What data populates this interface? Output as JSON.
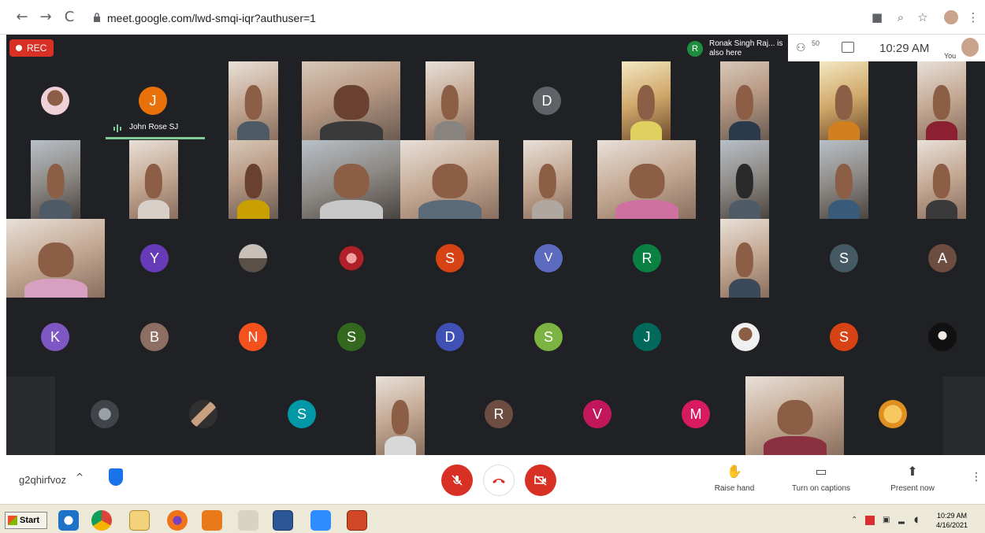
{
  "browser": {
    "url": "meet.google.com/lwd-smqi-iqr?authuser=1",
    "back": "←",
    "forward": "→",
    "reload": "C",
    "icons": [
      "camera-icon",
      "zoom-icon",
      "bookmark-star-icon",
      "profile-avatar",
      "menu-icon"
    ]
  },
  "meet": {
    "rec_label": "REC",
    "notification": {
      "initial": "R",
      "text": "Ronak Singh Raj... is also here"
    },
    "people_count": "50",
    "clock": "10:29 AM",
    "you_label": "You",
    "active_speaker": "John Rose SJ",
    "avatars": {
      "j": "J",
      "d": "D",
      "y": "Y",
      "s1": "S",
      "v1": "V",
      "r1": "R",
      "s2": "S",
      "a": "A",
      "k": "K",
      "b": "B",
      "n": "N",
      "s3": "S",
      "d2": "D",
      "s4": "S",
      "j2": "J",
      "s5": "S",
      "s6": "S",
      "r2": "R",
      "v2": "V",
      "m": "M"
    },
    "avatar_colors": {
      "orange": "#e8710a",
      "grey": "#5f6368",
      "purple": "#673ab7",
      "red": "#d84315",
      "indigo": "#5c6bc0",
      "green": "#0b8043",
      "slate": "#455a64",
      "brown": "#6d4c41",
      "lavender": "#7e57c2",
      "taupe": "#8d6e63",
      "amber": "#f4511e",
      "forest": "#33691e",
      "blue": "#3f51b5",
      "lime": "#7cb342",
      "teal": "#00796b",
      "cyan": "#0097a7",
      "maroon": "#6d4c41",
      "crimson": "#c2185b",
      "pink": "#d81b60"
    }
  },
  "toolbar": {
    "meeting_code": "g2qhirfvoz",
    "chevron": "^",
    "raise_hand": "Raise hand",
    "captions": "Turn on captions",
    "present": "Present now",
    "accent_red": "#d93025"
  },
  "taskbar": {
    "start": "Start",
    "time": "10:29 AM",
    "date": "4/16/2021"
  }
}
